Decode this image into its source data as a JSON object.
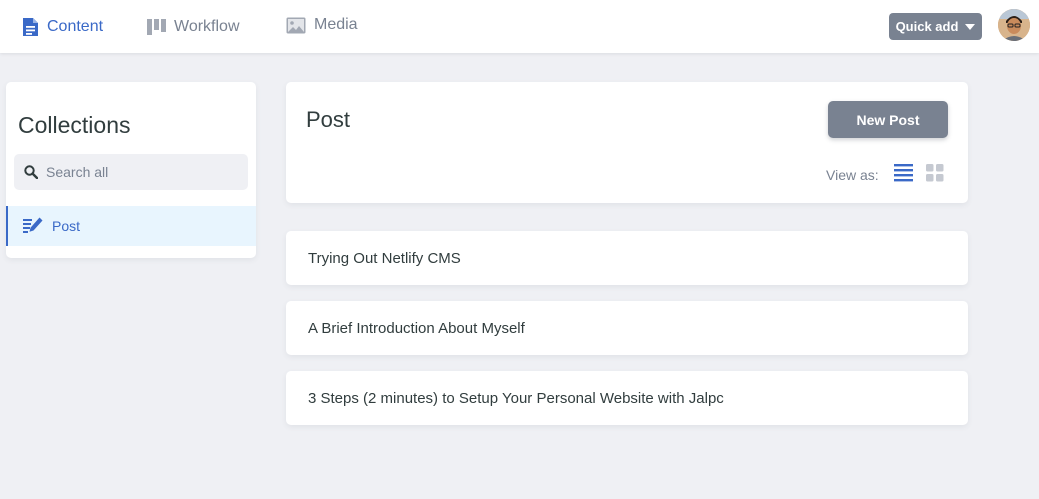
{
  "header": {
    "tabs": [
      {
        "label": "Content",
        "icon": "document-icon",
        "active": true
      },
      {
        "label": "Workflow",
        "icon": "workflow-board-icon",
        "active": false
      },
      {
        "label": "Media",
        "icon": "image-icon",
        "active": false
      }
    ],
    "quick_add_label": "Quick add",
    "avatar_icon": "user-avatar"
  },
  "sidebar": {
    "title": "Collections",
    "search_placeholder": "Search all",
    "search_value": "",
    "items": [
      {
        "label": "Post",
        "icon": "write-icon",
        "active": true
      }
    ]
  },
  "collection": {
    "title": "Post",
    "new_button_label": "New Post",
    "view_as_label": "View as:",
    "view_mode": "list"
  },
  "entries": [
    {
      "title": "Trying Out Netlify CMS"
    },
    {
      "title": "A Brief Introduction About Myself"
    },
    {
      "title": "3 Steps (2 minutes) to Setup Your Personal Website with Jalpc"
    }
  ],
  "colors": {
    "accent": "#3a69c7",
    "button_gray": "#798291",
    "background": "#eff0f4",
    "active_item_bg": "#e8f5fe",
    "text_dark": "#313d3e"
  }
}
